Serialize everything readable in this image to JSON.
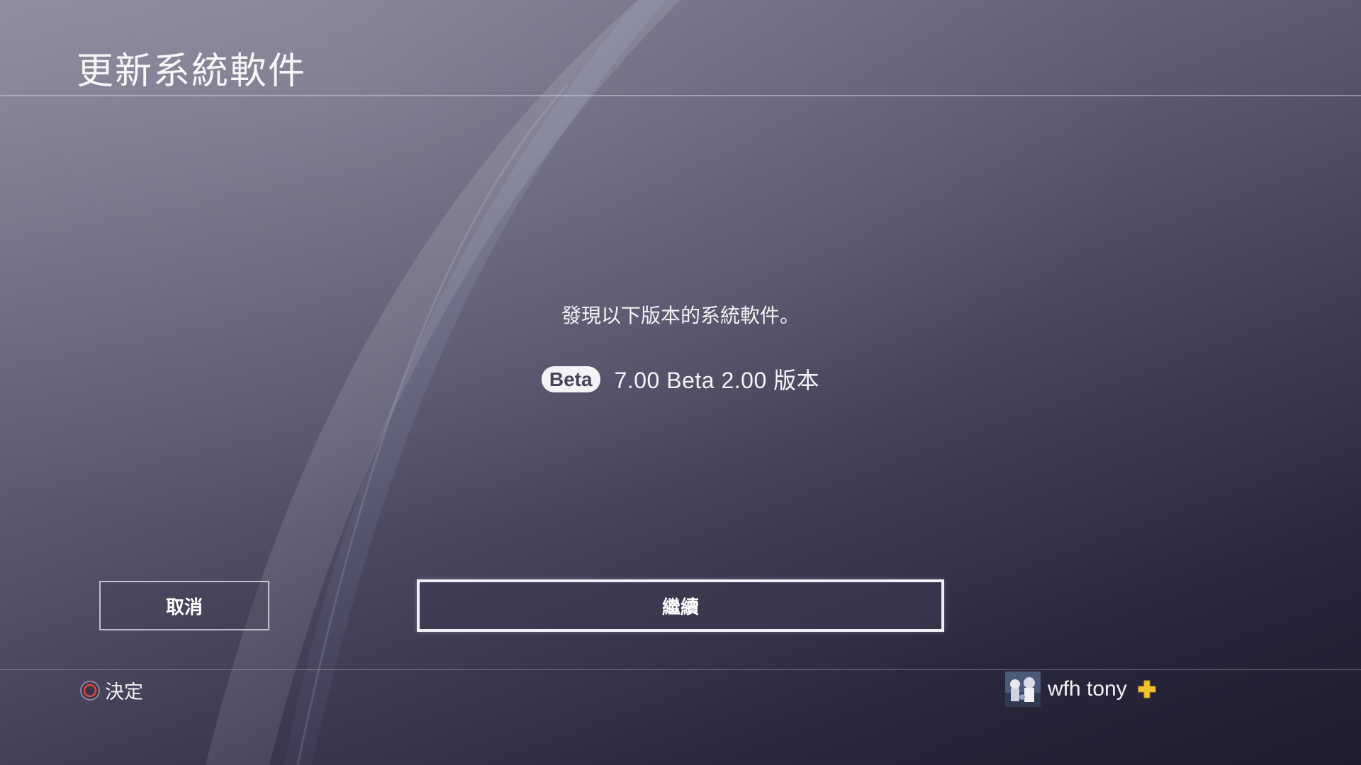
{
  "header": {
    "title": "更新系統軟件"
  },
  "main": {
    "message": "發現以下版本的系統軟件。",
    "badge": "Beta",
    "version": "7.00 Beta 2.00 版本"
  },
  "buttons": {
    "cancel_label": "取消",
    "continue_label": "繼續"
  },
  "footer": {
    "hint_icon": "circle-button-icon",
    "hint_label": "決定",
    "username": "wfh tony",
    "plus_icon": "playstation-plus-icon"
  },
  "colors": {
    "circle_button": "#e0463c",
    "plus": "#f1c232"
  }
}
